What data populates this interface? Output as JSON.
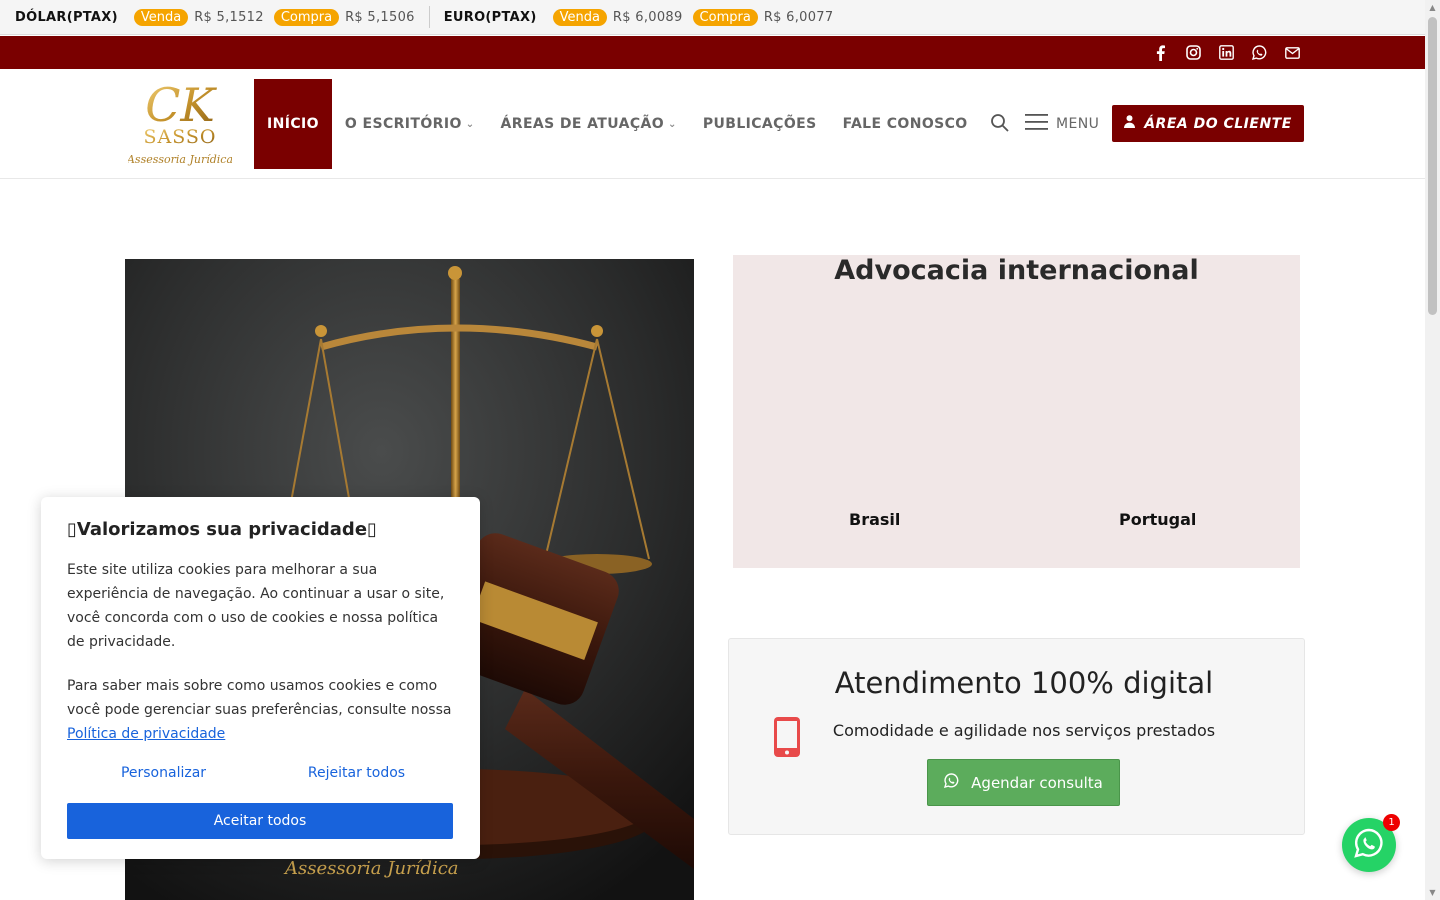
{
  "ticker": {
    "dolar_label": "DÓLAR(PTAX)",
    "dolar_sell_badge": "Venda",
    "dolar_sell_value": "R$ 5,1512",
    "dolar_buy_badge": "Compra",
    "dolar_buy_value": "R$ 5,1506",
    "euro_label": "EURO(PTAX)",
    "euro_sell_badge": "Venda",
    "euro_sell_value": "R$ 6,0089",
    "euro_buy_badge": "Compra",
    "euro_buy_value": "R$ 6,0077"
  },
  "social": {
    "icons": [
      "facebook-icon",
      "instagram-icon",
      "linkedin-icon",
      "whatsapp-icon",
      "mail-icon"
    ]
  },
  "header": {
    "logo_text": "CK",
    "logo_sub": "SASSO",
    "logo_tagline": "Assessoria Jurídica",
    "nav": [
      "INÍCIO",
      "O ESCRITÓRIO",
      "ÁREAS DE ATUAÇÃO",
      "PUBLICAÇÕES",
      "FALE CONOSCO"
    ],
    "menu_label": "MENU",
    "client_button": "ÁREA DO CLIENTE"
  },
  "hero": {
    "watermark": "Assessoria Jurídica"
  },
  "international": {
    "title": "Advocacia internacional",
    "country_1": "Brasil",
    "country_2": "Portugal"
  },
  "digital": {
    "title": "Atendimento 100% digital",
    "subtitle": "Comodidade e agilidade nos serviços prestados",
    "cta": "Agendar consulta"
  },
  "cookie": {
    "title": "Valorizamos sua privacidade",
    "paragraph_1": "Este site utiliza cookies para melhorar a sua experiência de navegação. Ao continuar a usar o site, você concorda com o uso de cookies e nossa política de privacidade.",
    "paragraph_2": "Para saber mais sobre como usamos cookies e como você pode gerenciar suas preferências, consulte nossa",
    "policy_link": "Política de privacidade",
    "customize": "Personalizar",
    "reject": "Rejeitar todos",
    "accept": "Aceitar todos"
  },
  "whatsapp_float": {
    "badge_count": "1"
  },
  "colors": {
    "brand": "#7a0000",
    "badge": "#f5a400",
    "cookie_accent": "#1863dc",
    "cta_green": "#5cac5c"
  }
}
